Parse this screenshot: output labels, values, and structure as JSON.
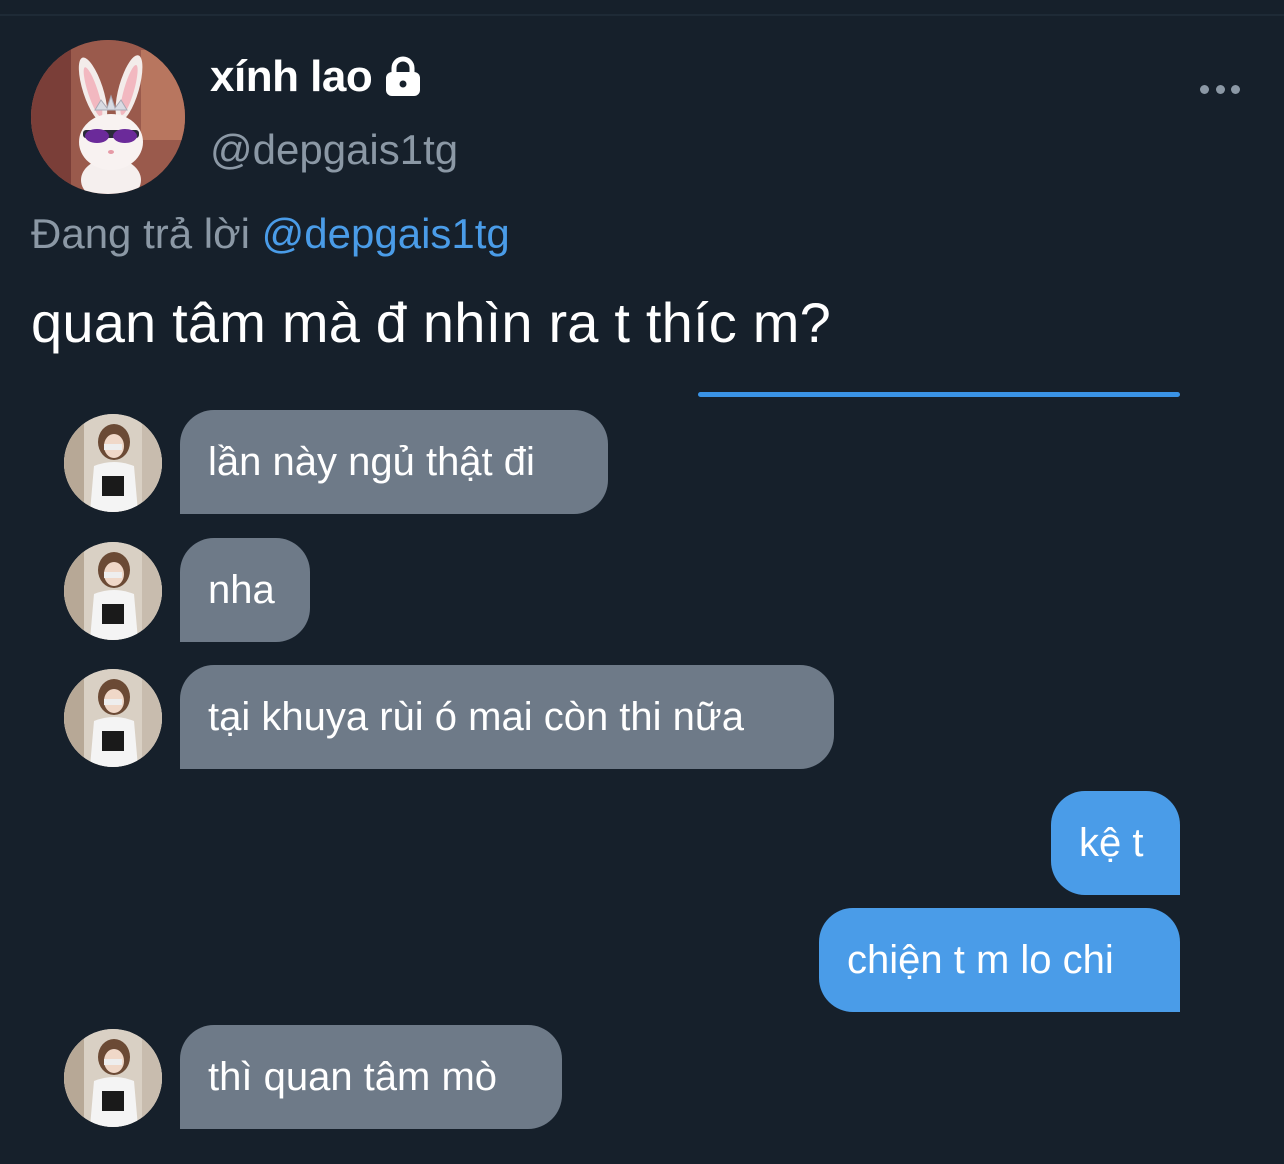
{
  "tweet": {
    "display_name": "xính lao",
    "handle": "@depgais1tg",
    "replying_prefix": "Đang trả lời",
    "replying_to": "@depgais1tg",
    "text": "quan tâm mà đ nhìn ra t thíc m?",
    "icons": {
      "lock": "lock-icon",
      "more": "more-icon",
      "avatar": "bunny-avatar"
    }
  },
  "screenshot_chat": {
    "messages": [
      {
        "direction": "incoming",
        "text": "lần này ngủ thật đi"
      },
      {
        "direction": "incoming",
        "text": "nha"
      },
      {
        "direction": "incoming",
        "text": "tại khuya rùi ó mai còn thi nữa"
      },
      {
        "direction": "outgoing",
        "text": "kệ t"
      },
      {
        "direction": "outgoing",
        "text": "chiện t m lo chi"
      },
      {
        "direction": "incoming",
        "text": "thì quan tâm mò"
      }
    ]
  },
  "colors": {
    "background": "#16202b",
    "incoming_bubble": "#6e7a88",
    "outgoing_bubble": "#4a9ce8",
    "mention": "#4a9ce8",
    "secondary_text": "#8b98a5"
  }
}
